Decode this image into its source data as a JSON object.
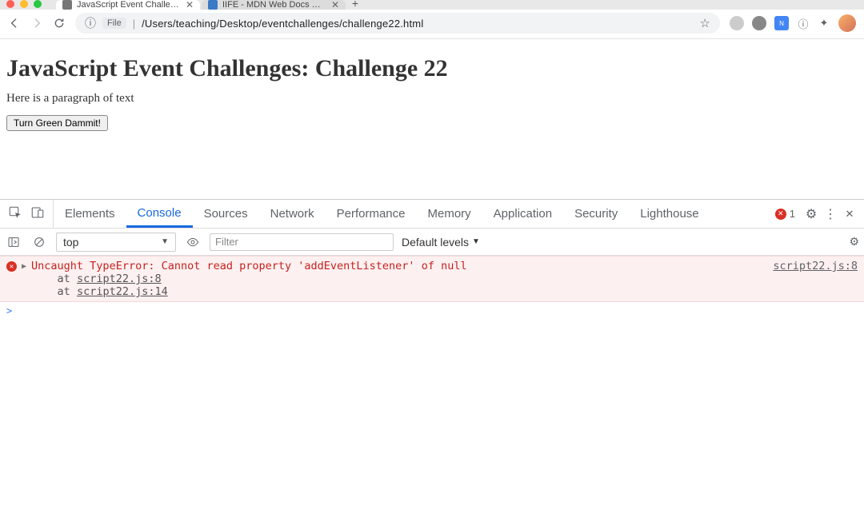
{
  "tabs": [
    {
      "title": "JavaScript Event Challenges: C",
      "active": true
    },
    {
      "title": "IIFE - MDN Web Docs Glossar",
      "active": false
    }
  ],
  "url_bar": {
    "scheme_label": "File",
    "path": "/Users/teaching/Desktop/eventchallenges/challenge22.html"
  },
  "page": {
    "heading": "JavaScript Event Challenges: Challenge 22",
    "paragraph": "Here is a paragraph of text",
    "button_label": "Turn Green Dammit!"
  },
  "devtools": {
    "tabs": [
      "Elements",
      "Console",
      "Sources",
      "Network",
      "Performance",
      "Memory",
      "Application",
      "Security",
      "Lighthouse"
    ],
    "active_tab": "Console",
    "error_count": "1",
    "console_bar": {
      "context": "top",
      "filter_placeholder": "Filter",
      "levels": "Default levels"
    },
    "error": {
      "message": "Uncaught TypeError: Cannot read property 'addEventListener' of null",
      "stack": [
        {
          "prefix": "at ",
          "link": "script22.js:8"
        },
        {
          "prefix": "at ",
          "link": "script22.js:14"
        }
      ],
      "source_link": "script22.js:8"
    },
    "prompt": ">"
  },
  "icons": {
    "back": "←",
    "forward": "→",
    "reload": "⟳",
    "info": "ⓘ",
    "star": "☆",
    "plus": "+",
    "ext": "✦",
    "gear": "⚙",
    "kebab": "⋮",
    "caret": "▼",
    "disclosure": "▶",
    "close": "✕",
    "x_err": "✕"
  }
}
